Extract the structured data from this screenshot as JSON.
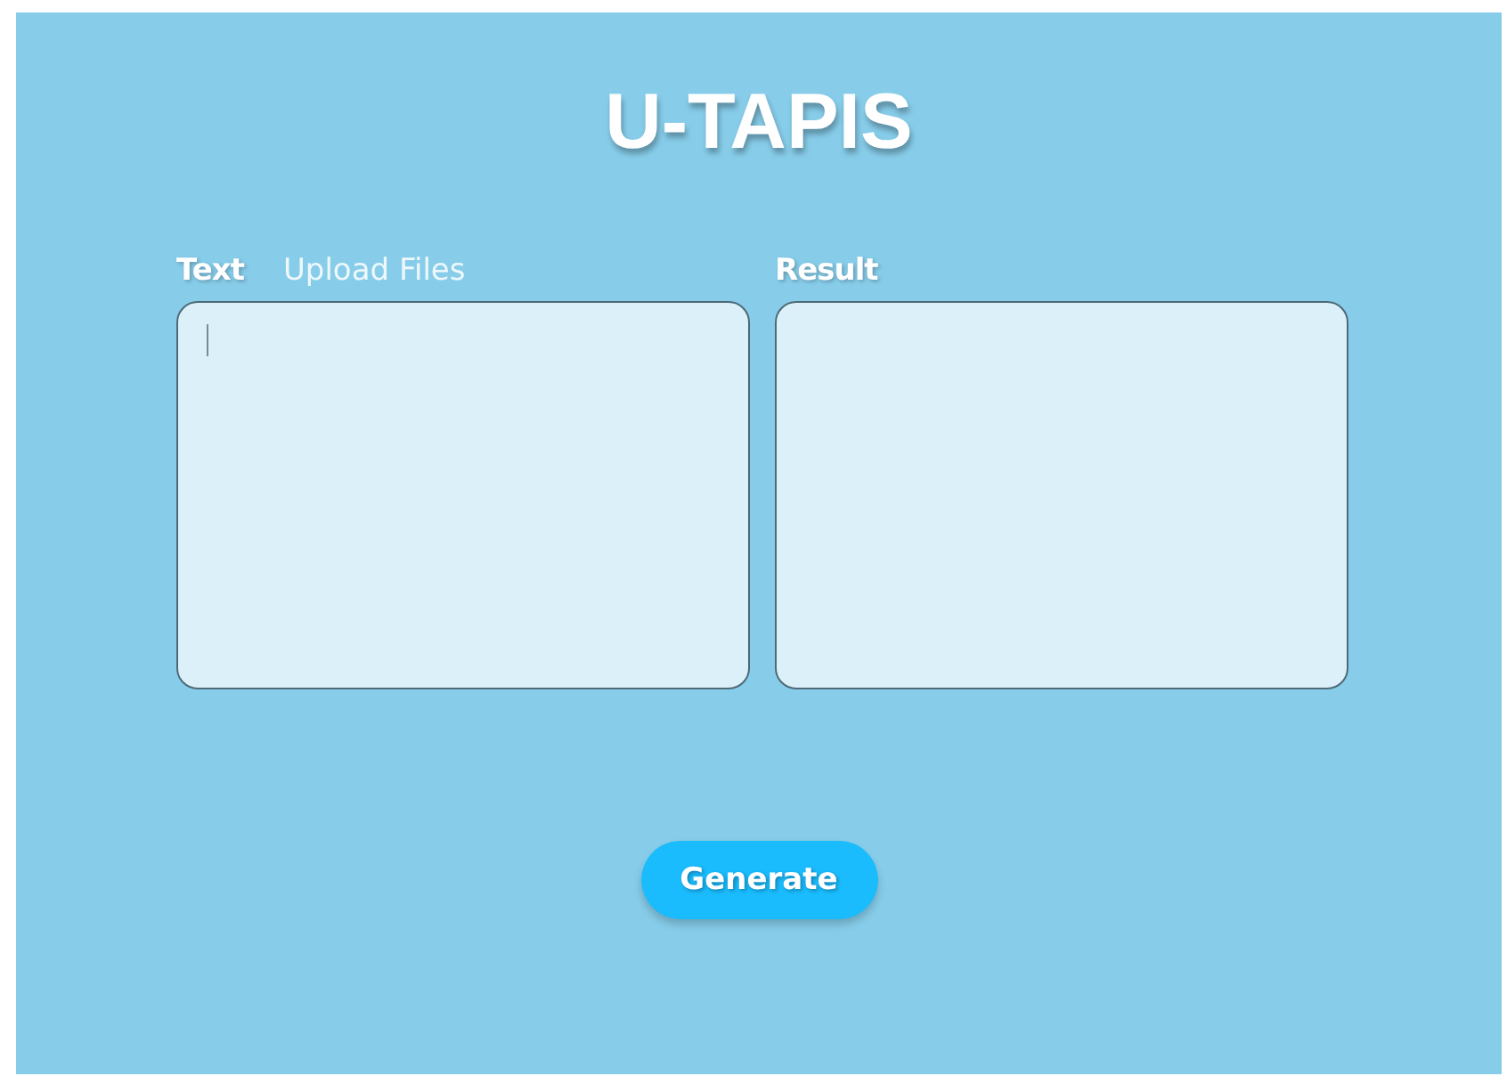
{
  "title": "U-TAPIS",
  "input_tabs": [
    {
      "label": "Text",
      "selected": true
    },
    {
      "label": "Upload Files",
      "selected": false
    }
  ],
  "result": {
    "label": "Result"
  },
  "generate_button": {
    "label": "Generate"
  }
}
